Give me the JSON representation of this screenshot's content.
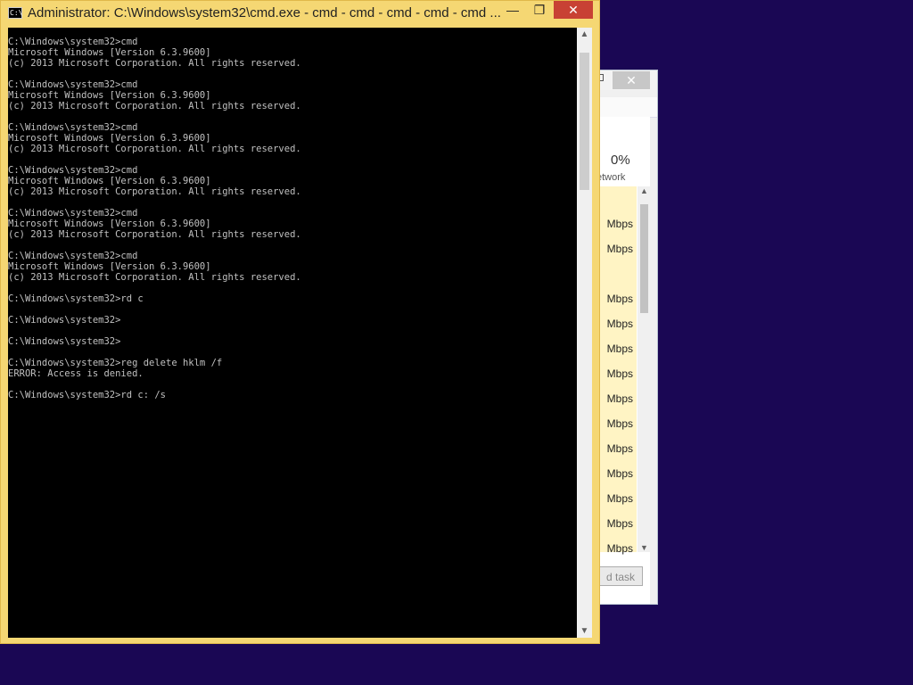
{
  "task_manager": {
    "network_percent": "0%",
    "network_label": "etwork",
    "rows": [
      "",
      "Mbps",
      "Mbps",
      "",
      "Mbps",
      "Mbps",
      "Mbps",
      "Mbps",
      "Mbps",
      "Mbps",
      "Mbps",
      "Mbps",
      "Mbps",
      "Mbps",
      "Mbps"
    ],
    "end_task_label": "d task",
    "close_glyph": "✕",
    "row_highlight_color": "#fff4c4"
  },
  "cmd": {
    "title": "Administrator: C:\\Windows\\system32\\cmd.exe - cmd - cmd - cmd - cmd - cmd ...",
    "icon_text": "C:\\",
    "controls": {
      "minimize": "—",
      "maximize": "❐",
      "close": "✕"
    },
    "console_lines": [
      "C:\\Windows\\system32>cmd",
      "Microsoft Windows [Version 6.3.9600]",
      "(c) 2013 Microsoft Corporation. All rights reserved.",
      "",
      "C:\\Windows\\system32>cmd",
      "Microsoft Windows [Version 6.3.9600]",
      "(c) 2013 Microsoft Corporation. All rights reserved.",
      "",
      "C:\\Windows\\system32>cmd",
      "Microsoft Windows [Version 6.3.9600]",
      "(c) 2013 Microsoft Corporation. All rights reserved.",
      "",
      "C:\\Windows\\system32>cmd",
      "Microsoft Windows [Version 6.3.9600]",
      "(c) 2013 Microsoft Corporation. All rights reserved.",
      "",
      "C:\\Windows\\system32>cmd",
      "Microsoft Windows [Version 6.3.9600]",
      "(c) 2013 Microsoft Corporation. All rights reserved.",
      "",
      "C:\\Windows\\system32>cmd",
      "Microsoft Windows [Version 6.3.9600]",
      "(c) 2013 Microsoft Corporation. All rights reserved.",
      "",
      "C:\\Windows\\system32>rd c",
      "",
      "C:\\Windows\\system32>",
      "",
      "C:\\Windows\\system32>",
      "",
      "C:\\Windows\\system32>reg delete hklm /f",
      "ERROR: Access is denied.",
      "",
      "C:\\Windows\\system32>rd c: /s"
    ],
    "colors": {
      "frame": "#f5d773",
      "console_bg": "#000000",
      "console_text": "#c0c0c0",
      "close_button": "#c84134",
      "desktop": "#1a0754"
    }
  }
}
